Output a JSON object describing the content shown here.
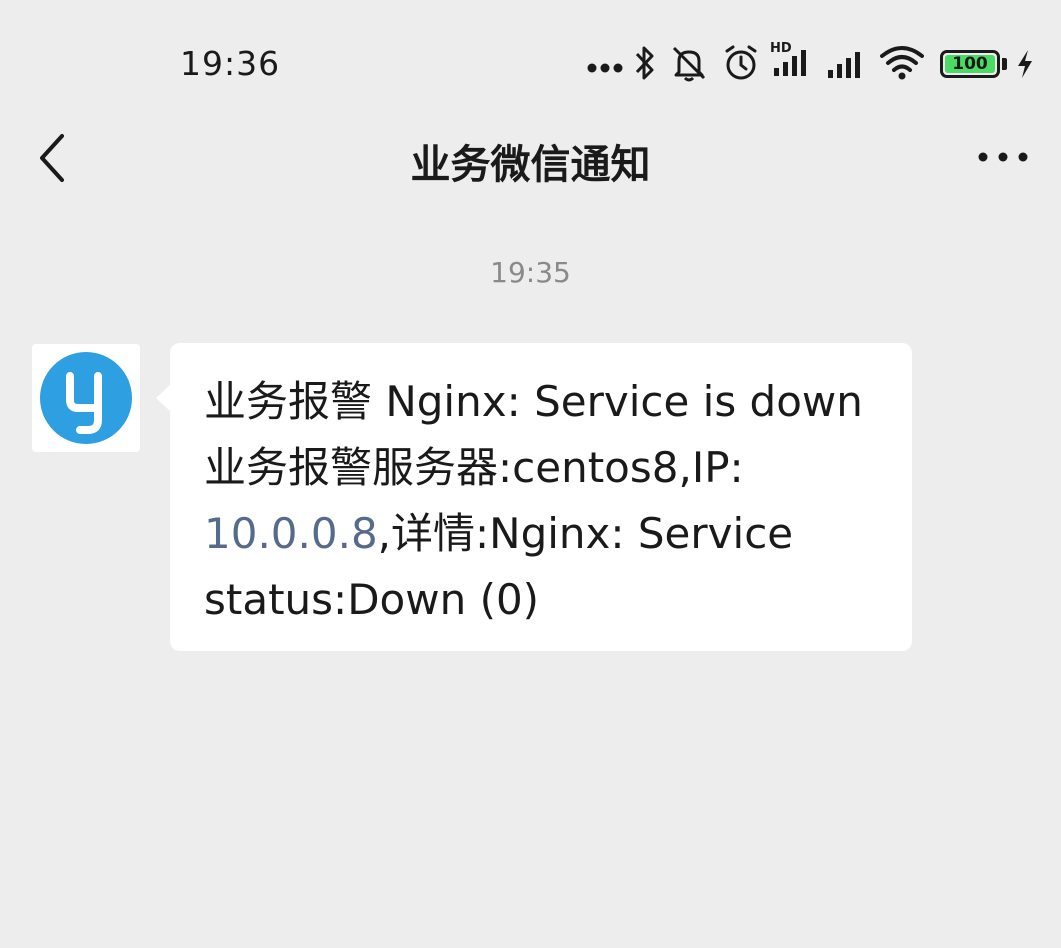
{
  "status_bar": {
    "time": "19:36",
    "battery_level": "100",
    "icons": [
      "more-dots-icon",
      "bluetooth-icon",
      "silent-icon",
      "alarm-icon",
      "hd-signal-icon",
      "signal-icon",
      "wifi-icon",
      "battery-icon",
      "charging-icon"
    ],
    "hd_label": "HD"
  },
  "nav": {
    "title": "业务微信通知"
  },
  "chat": {
    "timestamp": "19:35",
    "message": {
      "line1": "业务报警 Nginx: Service is down",
      "line2": "业务报警服务器:centos8,IP:",
      "ip": "10.0.0.8",
      "line3_rest": ",详情:Nginx: Service",
      "line4": "status:Down (0)"
    }
  },
  "colors": {
    "background": "#ededed",
    "bubble": "#ffffff",
    "avatar_blue": "#2e9fe0",
    "link": "#566b8c",
    "battery_green": "#4cd964"
  }
}
